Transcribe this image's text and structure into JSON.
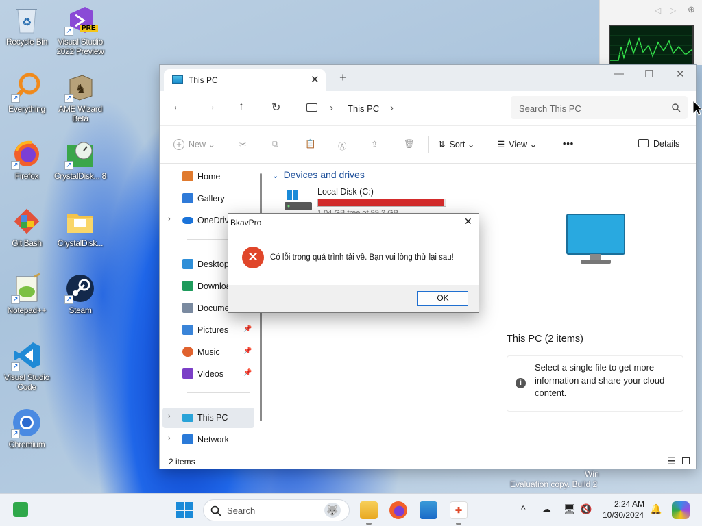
{
  "desktop": {
    "icons": [
      {
        "label": "Recycle Bin"
      },
      {
        "label": "Visual Studio 2022 Preview",
        "badge": "PRE"
      },
      {
        "label": "Everything"
      },
      {
        "label": "AME Wizard Beta"
      },
      {
        "label": "Firefox"
      },
      {
        "label": "CrystalDisk... 8"
      },
      {
        "label": "Git Bash"
      },
      {
        "label": "CrystalDisk..."
      },
      {
        "label": "Notepad++"
      },
      {
        "label": "Steam"
      },
      {
        "label": "Visual Studio Code"
      },
      {
        "label": "Chromium"
      }
    ],
    "watermark_line1": "Win",
    "watermark_line2": "Evaluation copy. Build 2"
  },
  "explorer": {
    "tab_title": "This PC",
    "tab_close": "✕",
    "new_tab": "+",
    "minimize": "—",
    "maximize": "☐",
    "close": "✕",
    "nav": {
      "back": "←",
      "forward": "→",
      "up": "↑",
      "refresh": "↻"
    },
    "breadcrumb": {
      "location": "This PC",
      "sep": "›",
      "more": "›"
    },
    "search_placeholder": "Search This PC",
    "commands": {
      "new": "New",
      "sort": "Sort",
      "view": "View",
      "more": "•••",
      "details": "Details"
    },
    "sidebar": [
      {
        "label": "Home",
        "color": "#e07a2e"
      },
      {
        "label": "Gallery",
        "color": "#2f7ad8"
      },
      {
        "label": "OneDrive",
        "color": "#1a73d9"
      },
      {
        "label": "Desktop",
        "color": "#2f8fd8"
      },
      {
        "label": "Downloads",
        "color": "#1e9b5c"
      },
      {
        "label": "Documents",
        "color": "#7a8aa0"
      },
      {
        "label": "Pictures",
        "color": "#3a84d8"
      },
      {
        "label": "Music",
        "color": "#e0622e"
      },
      {
        "label": "Videos",
        "color": "#7b3fc7"
      },
      {
        "label": "This PC",
        "color": "#2aa3d8"
      },
      {
        "label": "Network",
        "color": "#2a7ad8"
      }
    ],
    "group_header": "Devices and drives",
    "drive": {
      "name": "Local Disk (C:)",
      "free": "1.04 GB free of 99.2 GB",
      "used_fraction": 0.99,
      "bar_color": "#d42c2c"
    },
    "details_title": "This PC (2 items)",
    "details_info": "Select a single file to get more information and share your cloud content.",
    "status": "2 items"
  },
  "dialog": {
    "title": "BkavPro",
    "close": "✕",
    "message": "Có lỗi trong quá trình tải về. Bạn vui lòng thử lại sau!",
    "ok": "OK"
  },
  "taskbar": {
    "search_placeholder": "Search",
    "time": "2:24 AM",
    "date": "10/30/2024",
    "tray_chevron": "^"
  }
}
